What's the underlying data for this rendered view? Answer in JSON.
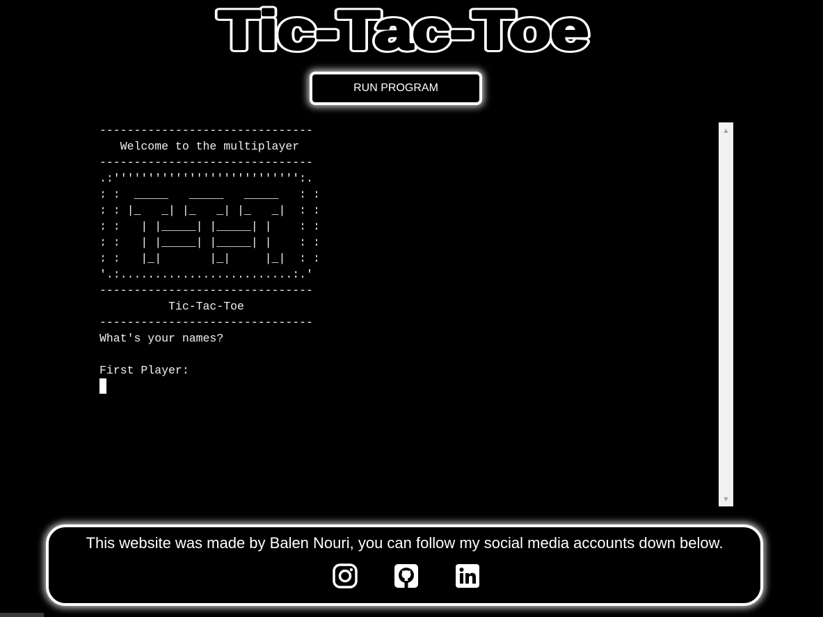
{
  "header": {
    "title": "Tic-Tac-Toe"
  },
  "toolbar": {
    "run_label": "RUN PROGRAM"
  },
  "terminal": {
    "lines": [
      "-------------------------------",
      "   Welcome to the multiplayer",
      "-------------------------------",
      ".:''''''''''''''''''''''''''':.",
      ": :  _____   _____   _____   : :",
      ": : |_   _| |_   _| |_   _|  : :",
      ": :   | |_____| |_____| |    : :",
      ": :   | |_____| |_____| |    : :",
      ": :   |_|       |_|     |_|  : :",
      "'.:.........................:.'",
      "-------------------------------",
      "          Tic-Tac-Toe",
      "-------------------------------",
      "What's your names?",
      "",
      "First Player:"
    ]
  },
  "footer": {
    "text": "This website was made by Balen Nouri, you can follow my social media accounts down below.",
    "icons": [
      "instagram-icon",
      "github-icon",
      "linkedin-icon"
    ]
  },
  "colors": {
    "background": "#000000",
    "foreground": "#ffffff",
    "scrollbar": "#f1f1f1"
  }
}
